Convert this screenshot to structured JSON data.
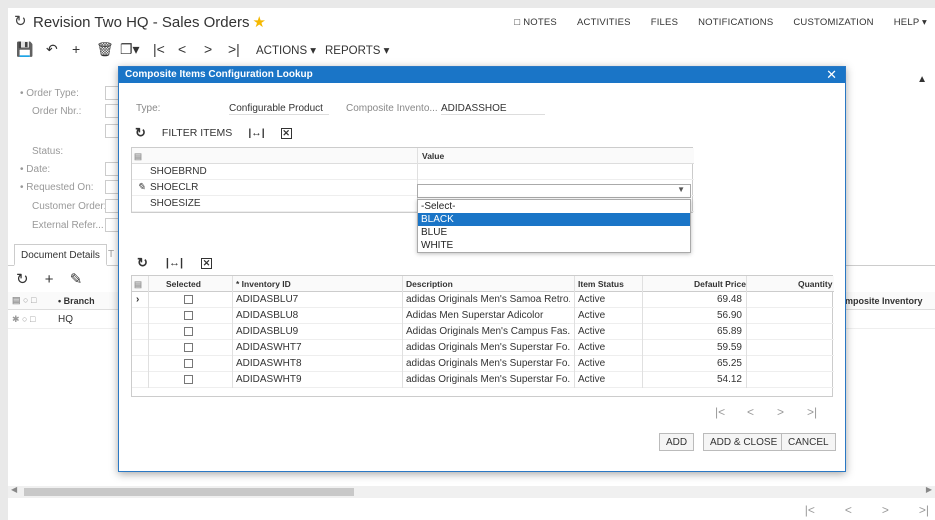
{
  "header": {
    "title": "Revision Two HQ - Sales Orders",
    "nav": [
      "NOTES",
      "ACTIVITIES",
      "FILES",
      "NOTIFICATIONS",
      "CUSTOMIZATION",
      "HELP ▾"
    ]
  },
  "toolbar": {
    "actions_label": "ACTIONS ▾",
    "reports_label": "REPORTS ▾"
  },
  "form": {
    "labels": [
      "• Order Type:",
      "Order Nbr.:",
      "Status:",
      "• Date:",
      "• Requested On:",
      "Customer Order:",
      "External Refer..."
    ]
  },
  "doc_tabs": {
    "active": "Document Details",
    "next": "T"
  },
  "bg_grid": {
    "branch_header": "• Branch",
    "composite_header": "Composite Inventory",
    "branch_value": "HQ"
  },
  "modal": {
    "title": "Composite Items Configuration Lookup",
    "type_label": "Type:",
    "type_value": "Configurable Product",
    "composite_label": "Composite Invento...",
    "composite_value": "ADIDASSHOE",
    "filter_label": "FILTER ITEMS",
    "attr_header": "Value",
    "attributes": [
      {
        "name": "SHOEBRND",
        "value": ""
      },
      {
        "name": "SHOECLR",
        "value": ""
      },
      {
        "name": "SHOESIZE",
        "value": ""
      }
    ],
    "dropdown_options": [
      "-Select-",
      "BLACK",
      "BLUE",
      "WHITE"
    ],
    "dropdown_selected": "BLACK",
    "items_columns": [
      "Selected",
      "* Inventory ID",
      "Description",
      "Item Status",
      "Default Price",
      "Quantity"
    ],
    "items": [
      {
        "id": "ADIDASBLU7",
        "description": "adidas Originals Men's Samoa Retro...",
        "status": "Active",
        "price": "69.48"
      },
      {
        "id": "ADIDASBLU8",
        "description": "Adidas Men Superstar Adicolor",
        "status": "Active",
        "price": "56.90"
      },
      {
        "id": "ADIDASBLU9",
        "description": "Adidas Originals Men's Campus Fas...",
        "status": "Active",
        "price": "65.89"
      },
      {
        "id": "ADIDASWHT7",
        "description": "adidas Originals Men's Superstar Fo...",
        "status": "Active",
        "price": "59.59"
      },
      {
        "id": "ADIDASWHT8",
        "description": "adidas Originals Men's Superstar Fo...",
        "status": "Active",
        "price": "65.25"
      },
      {
        "id": "ADIDASWHT9",
        "description": "adidas Originals Men's Superstar Fo...",
        "status": "Active",
        "price": "54.12"
      }
    ],
    "buttons": {
      "add": "ADD",
      "add_close": "ADD & CLOSE",
      "cancel": "CANCEL"
    }
  },
  "colors": {
    "accent": "#1a75c7",
    "star": "#f5b800"
  }
}
